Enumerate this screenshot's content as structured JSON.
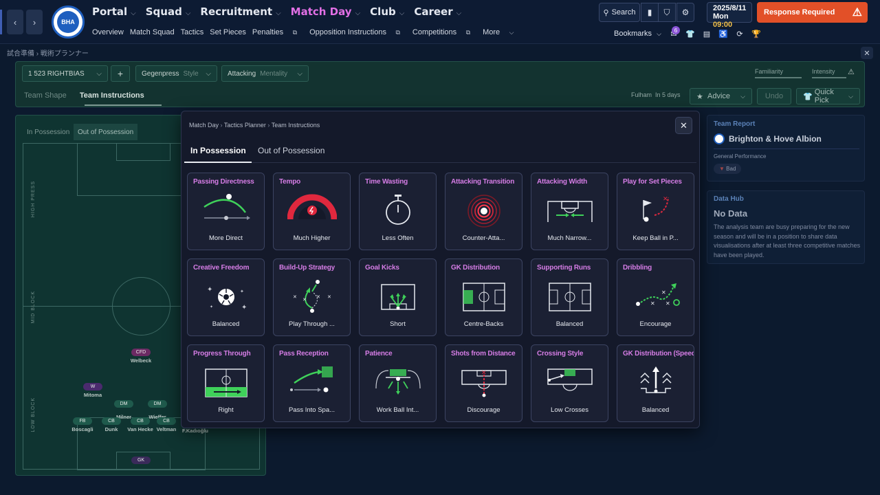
{
  "topbar": {
    "menu": [
      {
        "label": "Portal"
      },
      {
        "label": "Squad"
      },
      {
        "label": "Recruitment"
      },
      {
        "label": "Match Day"
      },
      {
        "label": "Club"
      },
      {
        "label": "Career"
      }
    ],
    "submenu": [
      "Overview",
      "Match Squad",
      "Tactics",
      "Set Pieces",
      "Penalties",
      "Opposition Instructions",
      "Competitions",
      "More"
    ],
    "search_label": "Search",
    "date": "2025/8/11",
    "day": "Mon",
    "time": "09:00",
    "response_label": "Response Required",
    "bookmarks_label": "Bookmarks",
    "notification_count": "6",
    "colors": {
      "accent": "#e16fe5",
      "response": "#e25028",
      "time": "#f4c24a"
    }
  },
  "page": {
    "breadcrumb": "試合準備 › 戦術プランナー"
  },
  "tactic": {
    "formation": "523 RIGHTBIAS",
    "formation_index": "1",
    "style_value": "Gegenpress",
    "style_label": "Style",
    "mentality_value": "Attacking",
    "mentality_label": "Mentality",
    "familiarity_label": "Familiarity",
    "intensity_label": "Intensity",
    "tabs": [
      "Team Shape",
      "Team Instructions"
    ],
    "next_match": "Fulham",
    "next_match_when": "In 5 days",
    "advice_label": "Advice",
    "undo_label": "Undo",
    "quickpick_label": "Quick Pick"
  },
  "pitch": {
    "tabs": [
      "In Possession",
      "Out of Possession"
    ],
    "zones": [
      "HIGH PRESS",
      "MID BLOCK",
      "LOW BLOCK"
    ],
    "players": [
      {
        "pos": "CFD",
        "name": "Welbeck",
        "color": "#6b2a63"
      },
      {
        "pos": "W",
        "name": "Mitoma",
        "color": "#4b2a6e"
      },
      {
        "pos": "DM",
        "name": "Milner",
        "color": "#1f5a4c"
      },
      {
        "pos": "DM",
        "name": "Wieffer",
        "color": "#1f5a4c"
      },
      {
        "pos": "FB",
        "name": "Boscagli",
        "color": "#1f5a4c"
      },
      {
        "pos": "CB",
        "name": "Dunk",
        "color": "#1f5a4c"
      },
      {
        "pos": "CB",
        "name": "Van Hecke",
        "color": "#1f5a4c"
      },
      {
        "pos": "CB",
        "name": "Veltman",
        "color": "#1f5a4c"
      },
      {
        "pos": "",
        "name": "F.Kadıoğlu",
        "color": "#1f5a4c"
      },
      {
        "pos": "GK",
        "name": "",
        "color": "#3a2a5a"
      }
    ]
  },
  "team_report": {
    "title": "Team Report",
    "club": "Brighton & Hove Albion",
    "perf_label": "General Performance",
    "perf_value": "Bad"
  },
  "data_hub": {
    "title": "Data Hub",
    "heading": "No Data",
    "body": "The analysis team are busy preparing for the new season and will be in a position to share data visualisations after at least three competitive matches have been played."
  },
  "modal": {
    "breadcrumb": [
      "Match Day",
      "Tactics Planner",
      "Team Instructions"
    ],
    "tabs": [
      "In Possession",
      "Out of Possession"
    ],
    "cards": [
      {
        "title": "Passing Directness",
        "value": "More Direct",
        "icon": "arc-ball-icon"
      },
      {
        "title": "Tempo",
        "value": "Much Higher",
        "icon": "tempo-gauge-icon"
      },
      {
        "title": "Time Wasting",
        "value": "Less Often",
        "icon": "stopwatch-icon"
      },
      {
        "title": "Attacking Transition",
        "value": "Counter-Atta...",
        "icon": "target-rings-icon"
      },
      {
        "title": "Attacking Width",
        "value": "Much Narrow...",
        "icon": "goal-narrow-icon"
      },
      {
        "title": "Play for Set Pieces",
        "value": "Keep Ball in P...",
        "icon": "corner-flag-icon"
      },
      {
        "title": "Creative Freedom",
        "value": "Balanced",
        "icon": "sparkle-ball-icon"
      },
      {
        "title": "Build-Up Strategy",
        "value": "Play Through ...",
        "icon": "build-up-icon"
      },
      {
        "title": "Goal Kicks",
        "value": "Short",
        "icon": "goal-kick-icon"
      },
      {
        "title": "GK Distribution",
        "value": "Centre-Backs",
        "icon": "gk-distribution-icon"
      },
      {
        "title": "Supporting Runs",
        "value": "Balanced",
        "icon": "supporting-runs-icon"
      },
      {
        "title": "Dribbling",
        "value": "Encourage",
        "icon": "dribble-path-icon"
      },
      {
        "title": "Progress Through",
        "value": "Right",
        "icon": "progress-right-icon"
      },
      {
        "title": "Pass Reception",
        "value": "Pass Into Spa...",
        "icon": "pass-space-icon"
      },
      {
        "title": "Patience",
        "value": "Work Ball Int...",
        "icon": "patience-box-icon"
      },
      {
        "title": "Shots from Distance",
        "value": "Discourage",
        "icon": "shots-distance-icon"
      },
      {
        "title": "Crossing Style",
        "value": "Low Crosses",
        "icon": "crossing-icon"
      },
      {
        "title": "GK Distribution (Speed",
        "value": "Balanced",
        "icon": "gk-speed-icon"
      }
    ]
  }
}
